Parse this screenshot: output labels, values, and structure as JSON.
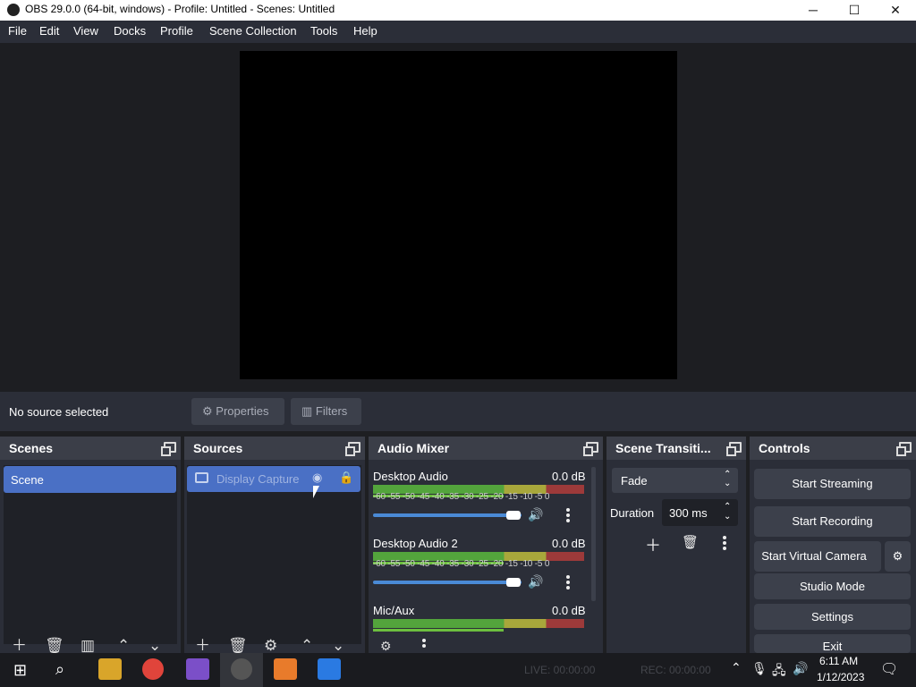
{
  "window": {
    "title": "OBS 29.0.0 (64-bit, windows) - Profile: Untitled - Scenes: Untitled",
    "minimize": "─",
    "maximize": "☐",
    "close": "✕"
  },
  "menu": [
    "File",
    "Edit",
    "View",
    "Docks",
    "Profile",
    "Scene Collection",
    "Tools",
    "Help"
  ],
  "context": {
    "no_source": "No source selected",
    "properties": "Properties",
    "filters": "Filters"
  },
  "scenes": {
    "title": "Scenes",
    "items": [
      "Scene"
    ]
  },
  "sources": {
    "title": "Sources",
    "items": [
      "Display Capture"
    ]
  },
  "mixer": {
    "title": "Audio Mixer",
    "scale": "-60 -55 -50 -45 -40 -35 -30 -25 -20 -15 -10 -5 0",
    "channels": [
      {
        "name": "Desktop Audio",
        "db": "0.0 dB"
      },
      {
        "name": "Desktop Audio 2",
        "db": "0.0 dB"
      },
      {
        "name": "Mic/Aux",
        "db": "0.0 dB"
      }
    ]
  },
  "transitions": {
    "title": "Scene Transiti...",
    "selected": "Fade",
    "duration_label": "Duration",
    "duration_value": "300 ms"
  },
  "controls": {
    "title": "Controls",
    "start_streaming": "Start Streaming",
    "start_recording": "Start Recording",
    "start_virtual": "Start Virtual Camera",
    "studio_mode": "Studio Mode",
    "settings": "Settings",
    "exit": "Exit"
  },
  "status": {
    "live": "LIVE: 00:00:00",
    "rec": "REC: 00:00:00"
  },
  "taskbar": {
    "time": "6:11 AM",
    "date": "1/12/2023"
  },
  "colors": {
    "accent": "#4a70c5",
    "panel": "#2b2e38",
    "background": "#1d1e22"
  }
}
